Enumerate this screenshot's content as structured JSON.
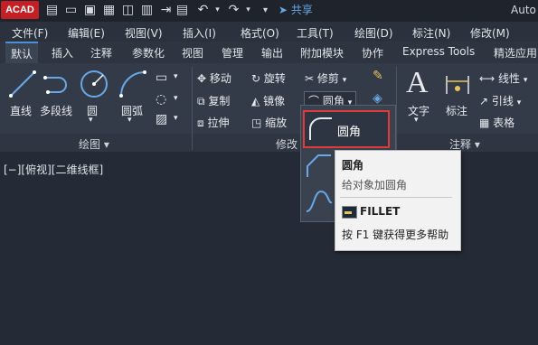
{
  "titlebar": {
    "logo_text": "CAD",
    "share_label": "共享",
    "app_title": "Auto"
  },
  "menus": [
    "文件(F)",
    "编辑(E)",
    "视图(V)",
    "插入(I)",
    "格式(O)",
    "工具(T)",
    "绘图(D)",
    "标注(N)",
    "修改(M)"
  ],
  "tabs": [
    "默认",
    "插入",
    "注释",
    "参数化",
    "视图",
    "管理",
    "输出",
    "附加模块",
    "协作",
    "Express Tools",
    "精选应用"
  ],
  "draw_panel": {
    "line": "直线",
    "polyline": "多段线",
    "circle": "圆",
    "arc": "圆弧",
    "title": "绘图"
  },
  "modify_panel": {
    "move": "移动",
    "rotate": "旋转",
    "trim": "修剪",
    "copy": "复制",
    "mirror": "镜像",
    "fillet": "圆角",
    "stretch": "拉伸",
    "scale": "缩放",
    "title": "修改"
  },
  "annotation_panel": {
    "text": "文字",
    "dimension": "标注",
    "linear": "线性",
    "leader": "引线",
    "table": "表格",
    "title": "注释"
  },
  "viewport_label": "[−][俯视][二维线框]",
  "dropdown": {
    "highlighted": "圆角"
  },
  "tooltip": {
    "title": "圆角",
    "description": "给对象加圆角",
    "command": "FILLET",
    "help": "按 F1 键获得更多帮助"
  }
}
